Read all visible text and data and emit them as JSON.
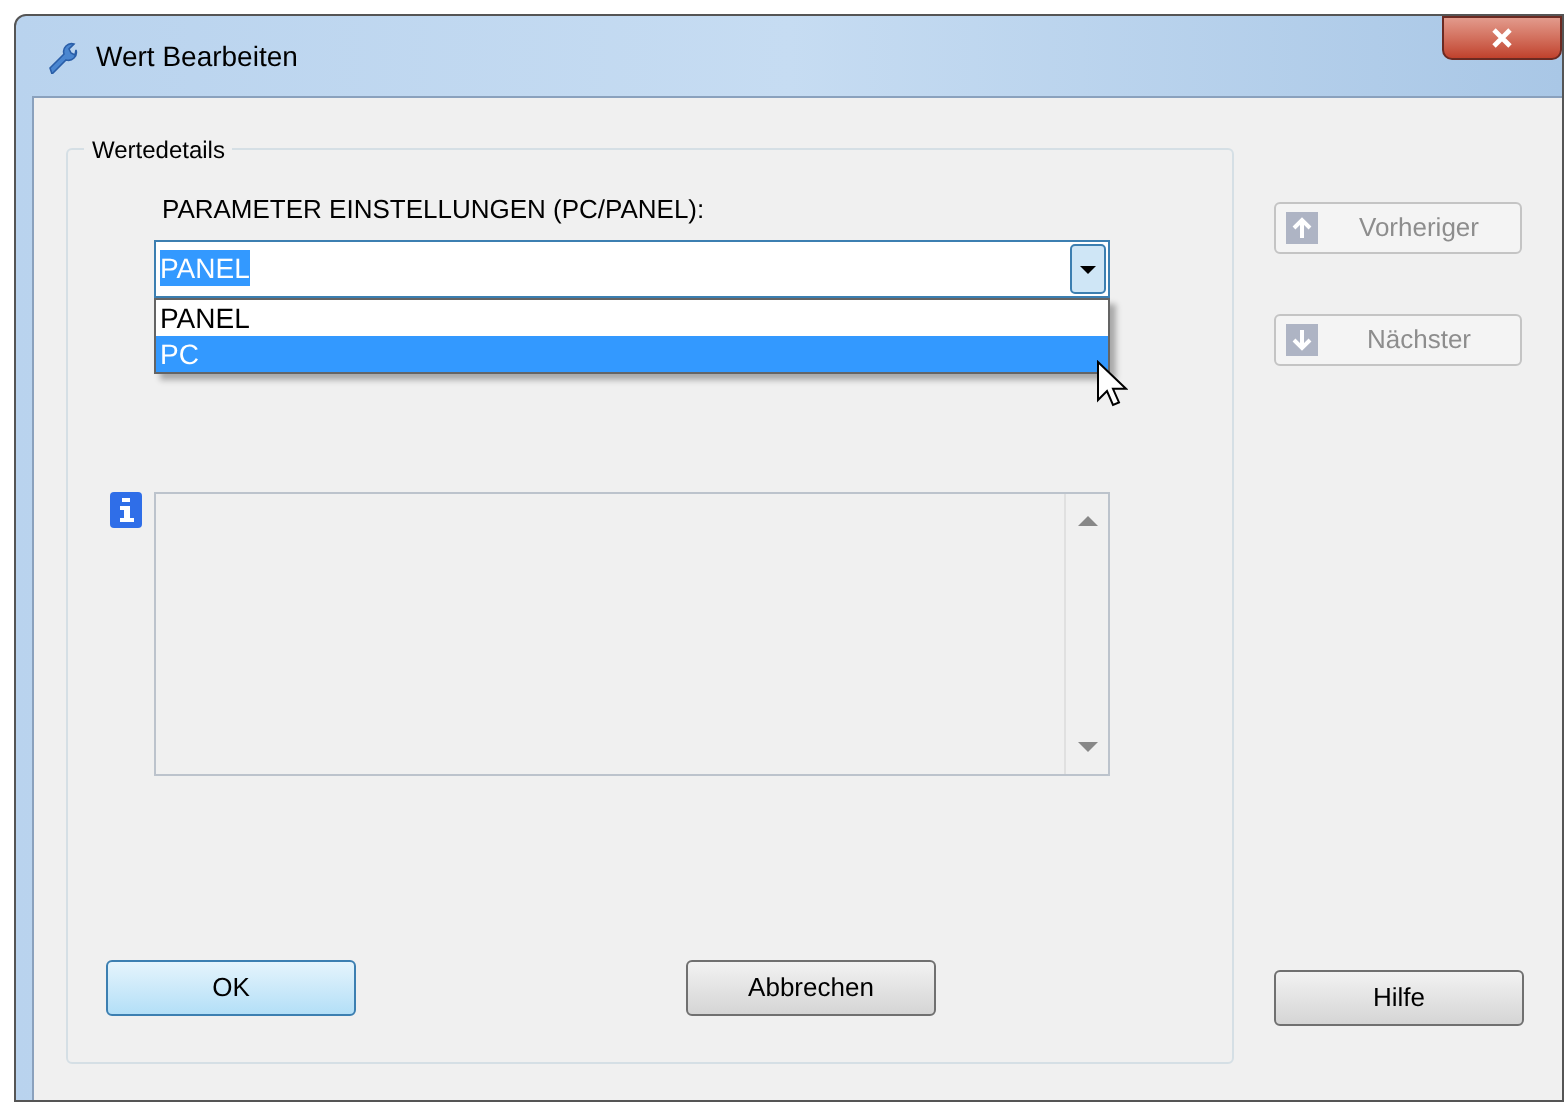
{
  "window": {
    "title": "Wert Bearbeiten"
  },
  "group": {
    "title": "Wertedetails"
  },
  "parameter": {
    "label": "PARAMETER EINSTELLUNGEN (PC/PANEL):",
    "value": "PANEL",
    "value_selected": true,
    "expanded": true,
    "options": [
      {
        "label": "PANEL",
        "highlighted": false
      },
      {
        "label": "PC",
        "highlighted": true
      }
    ]
  },
  "nav_buttons": [
    {
      "label": "Vorheriger",
      "kind": "up",
      "disabled": true
    },
    {
      "label": "Nächster",
      "kind": "down",
      "disabled": true
    }
  ],
  "buttons": [
    {
      "label": "OK",
      "default": true
    },
    {
      "label": "Abbrechen",
      "default": false
    }
  ],
  "help_button": {
    "label": "Hilfe"
  }
}
